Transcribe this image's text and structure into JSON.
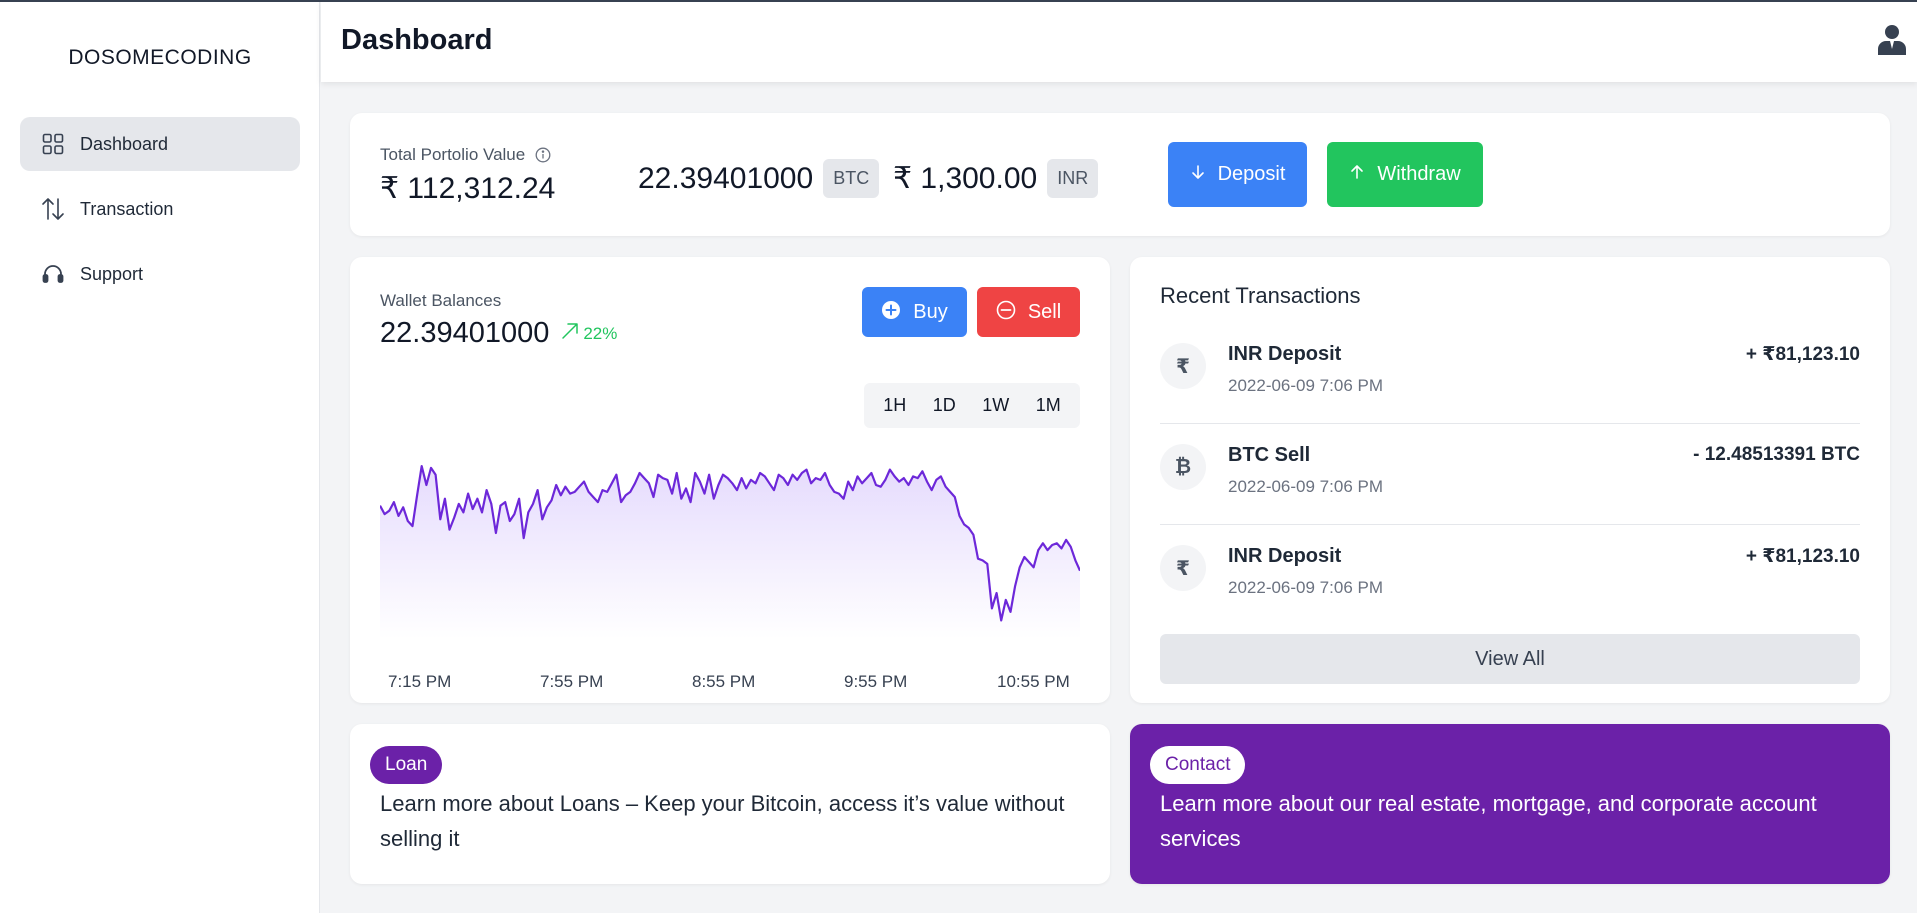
{
  "app": {
    "brand": "DOSOMECODING"
  },
  "sidebar": {
    "items": [
      {
        "label": "Dashboard",
        "icon": "grid-icon",
        "active": true
      },
      {
        "label": "Transaction",
        "icon": "arrows-up-down-icon",
        "active": false
      },
      {
        "label": "Support",
        "icon": "headset-icon",
        "active": false
      }
    ]
  },
  "header": {
    "title": "Dashboard",
    "user_icon": "user-icon"
  },
  "portfolio": {
    "label": "Total Portolio Value",
    "value": "₹ 112,312.24",
    "btc_amount": "22.39401000",
    "btc_unit": "BTC",
    "inr_amount": "₹ 1,300.00",
    "inr_unit": "INR",
    "deposit_label": "Deposit",
    "withdraw_label": "Withdraw"
  },
  "wallet": {
    "label": "Wallet Balances",
    "value": "22.39401000",
    "change": "22%",
    "buy_label": "Buy",
    "sell_label": "Sell",
    "timeframes": [
      "1H",
      "1D",
      "1W",
      "1M"
    ]
  },
  "chart_data": {
    "type": "area",
    "title": "",
    "xlabel": "",
    "ylabel": "",
    "x_ticks": [
      "7:15 PM",
      "7:55 PM",
      "8:55 PM",
      "9:55 PM",
      "10:55 PM"
    ],
    "values": [
      42,
      37,
      39,
      44,
      36,
      41,
      33,
      30,
      48,
      65,
      54,
      64,
      60,
      34,
      46,
      28,
      35,
      43,
      38,
      49,
      40,
      46,
      38,
      51,
      43,
      26,
      42,
      44,
      33,
      37,
      46,
      23,
      38,
      43,
      51,
      34,
      41,
      45,
      54,
      48,
      53,
      49,
      50,
      53,
      56,
      50,
      47,
      44,
      51,
      50,
      55,
      60,
      44,
      48,
      50,
      55,
      61,
      58,
      55,
      47,
      60,
      58,
      57,
      49,
      61,
      46,
      52,
      44,
      61,
      56,
      49,
      60,
      46,
      54,
      60,
      58,
      55,
      51,
      58,
      52,
      57,
      55,
      61,
      59,
      55,
      51,
      60,
      58,
      54,
      60,
      57,
      61,
      63,
      55,
      58,
      57,
      61,
      54,
      50,
      49,
      46,
      56,
      51,
      59,
      55,
      58,
      61,
      54,
      53,
      57,
      63,
      59,
      56,
      58,
      54,
      59,
      58,
      62,
      56,
      51,
      57,
      59,
      53,
      50,
      47,
      36,
      31,
      29,
      25,
      11,
      10,
      8,
      -18,
      -9,
      -25,
      -13,
      -20,
      -5,
      6,
      12,
      9,
      6,
      16,
      20,
      16,
      19,
      20,
      17,
      22,
      18,
      10,
      4
    ],
    "ylim": [
      -30,
      75
    ],
    "series": [
      {
        "values_ref": "values",
        "color": "#6d28d9"
      }
    ]
  },
  "recent": {
    "title": "Recent Transactions",
    "items": [
      {
        "symbol": "₹",
        "name": "INR Deposit",
        "date": "2022-06-09 7:06 PM",
        "amount": "+ ₹81,123.10"
      },
      {
        "symbol": "₿",
        "name": "BTC Sell",
        "date": "2022-06-09 7:06 PM",
        "amount": "- 12.48513391 BTC"
      },
      {
        "symbol": "₹",
        "name": "INR Deposit",
        "date": "2022-06-09 7:06 PM",
        "amount": "+ ₹81,123.10"
      }
    ],
    "view_all": "View All"
  },
  "loan": {
    "tag": "Loan",
    "text": "Learn more about Loans – Keep your Bitcoin, access it’s value without selling it"
  },
  "contact": {
    "tag": "Contact",
    "text": "Learn more about our real estate, mortgage, and corporate account services"
  },
  "colors": {
    "primary": "#3b82f6",
    "success": "#22c55e",
    "danger": "#ef4444",
    "purple": "#6b21a8",
    "chart_line": "#6d28d9"
  }
}
